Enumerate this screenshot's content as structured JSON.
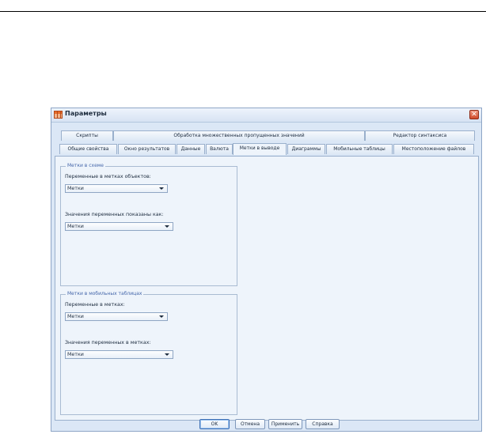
{
  "window": {
    "title": "Параметры",
    "close_glyph": "✕"
  },
  "tabs_row1": [
    "Скрипты",
    "Обработка множественных пропущенных значений",
    "Редактор синтаксиса"
  ],
  "tabs_row2": [
    "Общие свойства",
    "Окно результатов",
    "Данные",
    "Валюта",
    "Метки в выводе",
    "Диаграммы",
    "Мобильные таблицы",
    "Местоположение файлов"
  ],
  "active_tab": "Метки в выводе",
  "outline_group": {
    "title": "Метки в схеме",
    "variables_label": "Переменные в метках объектов:",
    "variables_value": "Метки",
    "values_label": "Значения переменных показаны как:",
    "values_value": "Метки"
  },
  "pivot_group": {
    "title": "Метки в мобильных таблицах",
    "variables_label": "Переменные в метках:",
    "variables_value": "Метки",
    "values_label": "Значения переменных в метках:",
    "values_value": "Метки"
  },
  "buttons": {
    "ok": "OK",
    "cancel": "Отмена",
    "apply": "Применить",
    "help": "Справка"
  },
  "icons": {
    "app": "spss-table-icon",
    "close": "close-icon",
    "dropdown": "chevron-down-icon"
  }
}
